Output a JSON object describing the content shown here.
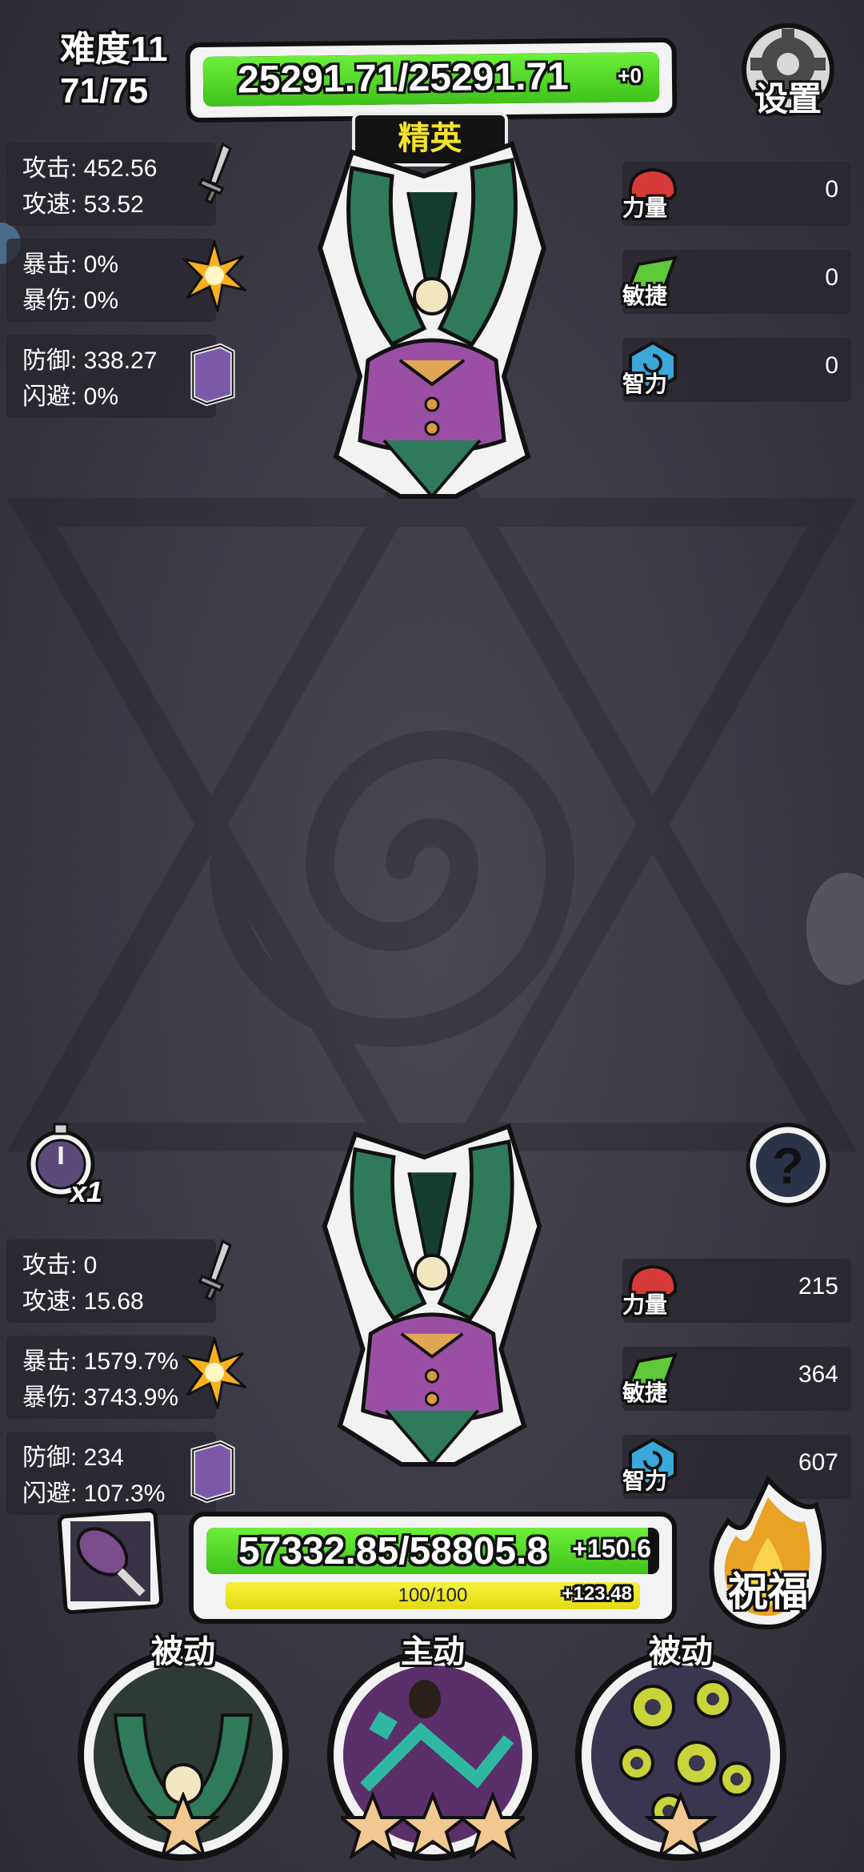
{
  "header": {
    "difficulty": "难度11",
    "wave": "71/75",
    "settings_label": "设置"
  },
  "enemy": {
    "hp_text": "25291.71/25291.71",
    "hp_regen": "+0",
    "hp_fraction": 1.0,
    "rank": "精英",
    "stats": {
      "attack": "攻击: 452.56",
      "attack_speed": "攻速: 53.52",
      "crit": "暴击: 0%",
      "crit_damage": "暴伤: 0%",
      "defense": "防御: 338.27",
      "dodge": "闪避: 0%"
    },
    "attributes": [
      {
        "label": "力量",
        "value": "0",
        "icon": "strength-claw-icon"
      },
      {
        "label": "敏捷",
        "value": "0",
        "icon": "agility-feather-icon"
      },
      {
        "label": "智力",
        "value": "0",
        "icon": "intelligence-swirl-icon"
      }
    ]
  },
  "player": {
    "speed_multiplier": "x1",
    "hp_text": "57332.85/58805.8",
    "hp_regen": "+150.6",
    "hp_fraction": 0.975,
    "energy_text": "100/100",
    "energy_regen": "+123.48",
    "energy_fraction": 1.0,
    "stats": {
      "attack": "攻击: 0",
      "attack_speed": "攻速: 15.68",
      "crit": "暴击: 1579.7%",
      "crit_damage": "暴伤: 3743.9%",
      "defense": "防御: 234",
      "dodge": "闪避: 107.3%"
    },
    "attributes": [
      {
        "label": "力量",
        "value": "215",
        "icon": "strength-claw-icon"
      },
      {
        "label": "敏捷",
        "value": "364",
        "icon": "agility-feather-icon"
      },
      {
        "label": "智力",
        "value": "607",
        "icon": "intelligence-swirl-icon"
      }
    ],
    "blessing_label": "祝福",
    "skills": [
      {
        "type": "被动",
        "stars": 1,
        "icon": "plant-jaw-skill-icon"
      },
      {
        "type": "主动",
        "stars": 3,
        "icon": "purple-figure-skill-icon"
      },
      {
        "type": "被动",
        "stars": 1,
        "icon": "green-rings-skill-icon"
      }
    ]
  },
  "colors": {
    "hp_green": "#4fd627",
    "energy_yellow": "#f0e623",
    "elite_yellow": "#f3e32a",
    "panel_bg": "#2b2931"
  }
}
